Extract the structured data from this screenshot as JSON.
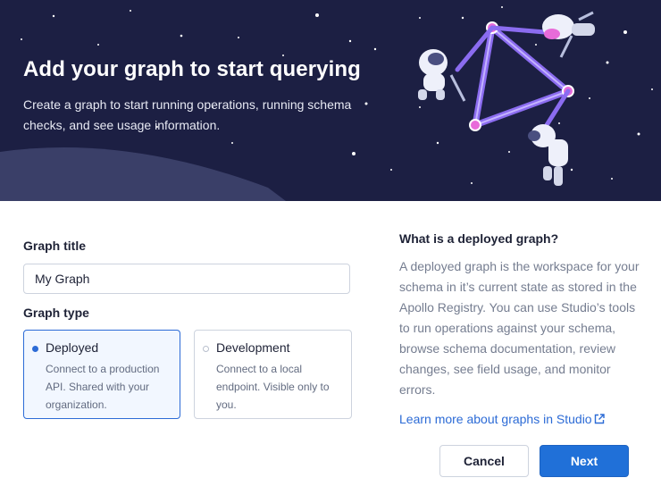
{
  "hero": {
    "title": "Add your graph to start querying",
    "subtitle": "Create a graph to start running operations, running schema checks, and see usage information."
  },
  "form": {
    "graph_title_label": "Graph title",
    "graph_title_value": "My Graph",
    "graph_type_label": "Graph type",
    "options": [
      {
        "title": "Deployed",
        "description": "Connect to a production API. Shared with your organization.",
        "selected": true
      },
      {
        "title": "Development",
        "description": "Connect to a local endpoint. Visible only to you.",
        "selected": false
      }
    ]
  },
  "info": {
    "heading": "What is a deployed graph?",
    "body": "A deployed graph is the workspace for your schema in it’s current state as stored in the Apollo Registry. You can use Studio’s tools to run operations against your schema, browse schema documentation, review changes, see field usage, and monitor errors.",
    "link": "Learn more about graphs in Studio"
  },
  "actions": {
    "cancel": "Cancel",
    "next": "Next"
  },
  "colors": {
    "hero_bg": "#1c1f43",
    "accent": "#2070d8",
    "selected_card_bg": "#f2f7ff",
    "illustration_purple": "#8b6cf0"
  },
  "icons": {
    "external_link": "external-link-icon",
    "illustration": "astronauts-illustration"
  }
}
